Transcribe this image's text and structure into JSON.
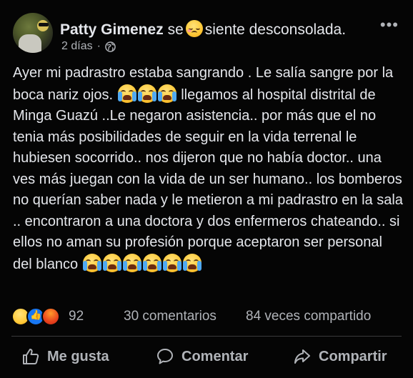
{
  "post": {
    "author_name": "Patty Gimenez",
    "feeling_prefix": "se",
    "feeling_text": "siente desconsolada.",
    "timestamp": "2 días",
    "separator": "·",
    "more": "•••",
    "text_part1": "Ayer mi padrastro estaba sangrando . Le salía sangre por la boca nariz ojos.",
    "text_part2": "llegamos al hospital distrital  de Minga Guazú ..Le negaron asistencia.. por más que el no tenia más posibilidades de seguir en la vida terrenal le hubiesen socorrido.. nos dijeron que no había doctor.. una ves más juegan con la vida de un ser humano.. los bomberos no querían saber nada y le metieron a mi padrastro en la sala .. encontraron a  una doctora y dos enfermeros chateando.. si ellos no aman su profesión porque aceptaron ser personal del blanco",
    "icons": {
      "feeling": "sad-face-emoji",
      "crying": "loudly-crying-face-emoji",
      "privacy": "globe-icon",
      "options": "more-options-icon"
    }
  },
  "stats": {
    "reactions_count": "92",
    "comments": "30 comentarios",
    "shares": "84 veces compartido"
  },
  "actions": {
    "like": "Me gusta",
    "comment": "Comentar",
    "share": "Compartir"
  },
  "colors": {
    "background": "#050505",
    "text": "#e4e6eb",
    "secondary_text": "#b0b3b8"
  }
}
